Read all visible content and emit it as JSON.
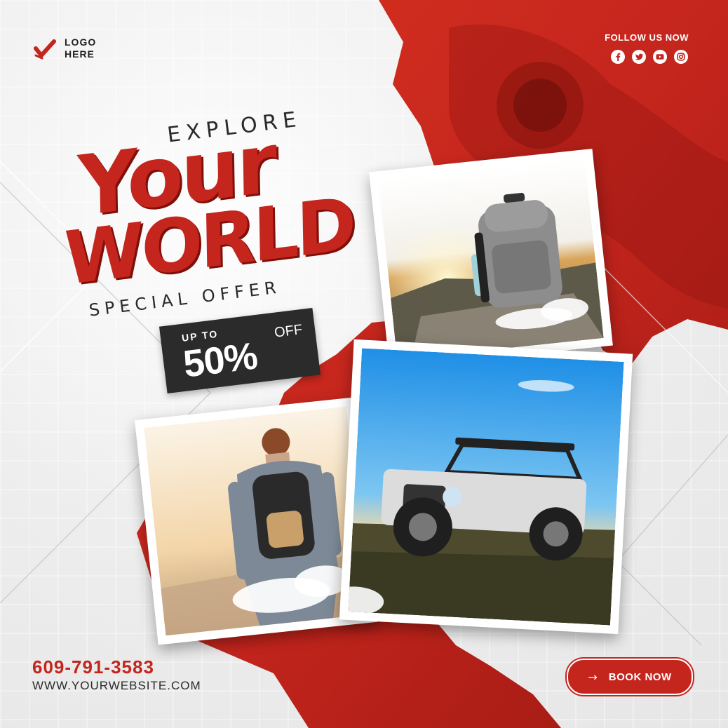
{
  "logo": {
    "text": "LOGO\nHERE",
    "line1": "LOGO",
    "line2": "HERE",
    "icon": "check-mark-icon"
  },
  "follow": {
    "label": "FOLLOW US NOW",
    "icons": [
      "facebook-icon",
      "twitter-icon",
      "youtube-icon",
      "instagram-icon"
    ]
  },
  "headline": {
    "explore": "EXPLORE",
    "your": "Your",
    "world": "WORLD",
    "special": "SPECIAL OFFER"
  },
  "offer": {
    "up_to": "UP TO",
    "percent": "50%",
    "off": "OFF"
  },
  "photos": [
    "backpack-photo",
    "jeep-photo",
    "hiker-photo"
  ],
  "contact": {
    "phone": "609-791-3583",
    "website": "WWW.YOURWEBSITE.COM"
  },
  "cta": {
    "label": "BOOK NOW",
    "icon": "arrow-right-icon"
  },
  "colors": {
    "accent": "#c4251d",
    "dark": "#2b2b2b",
    "background": "#ececec"
  }
}
